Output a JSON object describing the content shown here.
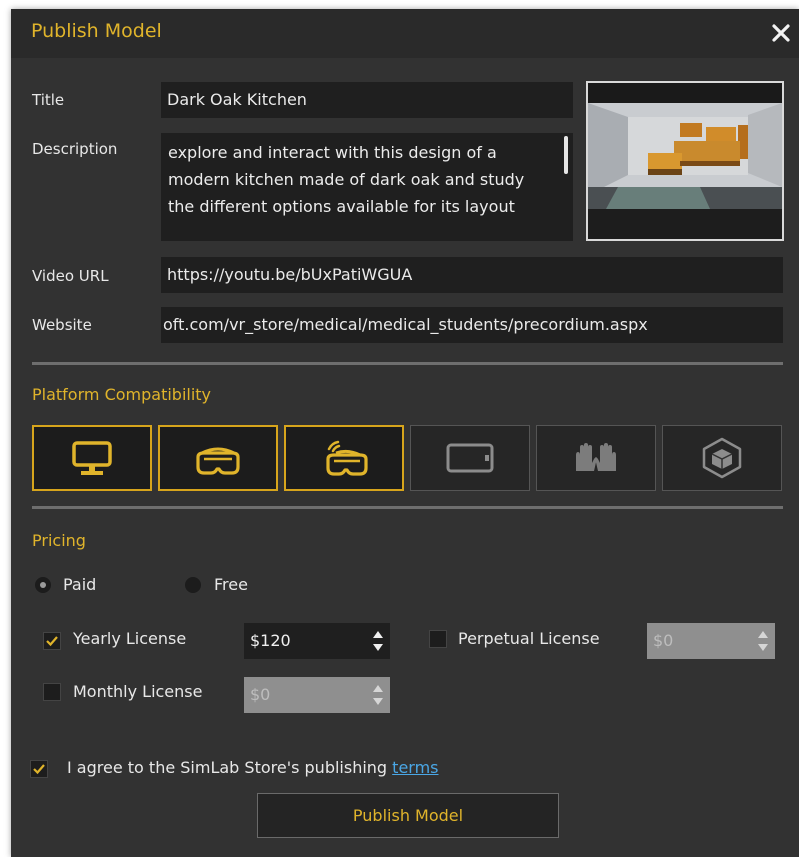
{
  "dialog": {
    "title": "Publish Model"
  },
  "form": {
    "title_label": "Title",
    "title_value": "Dark Oak Kitchen",
    "description_label": "Description",
    "description_value": "explore and interact with this design of a modern kitchen made of dark oak and study the different options available for its layout",
    "video_label": "Video URL",
    "video_value": "https://youtu.be/bUxPatiWGUA",
    "website_label": "Website",
    "website_value": "oft.com/vr_store/medical/medical_students/precordium.aspx"
  },
  "platform": {
    "heading": "Platform Compatibility",
    "items": [
      {
        "icon": "desktop-monitor-icon",
        "selected": true
      },
      {
        "icon": "vr-headset-icon",
        "selected": true
      },
      {
        "icon": "wireless-vr-headset-icon",
        "selected": true
      },
      {
        "icon": "tablet-icon",
        "selected": false
      },
      {
        "icon": "hands-icon",
        "selected": false
      },
      {
        "icon": "ar-cube-icon",
        "selected": false
      }
    ]
  },
  "pricing": {
    "heading": "Pricing",
    "paid_label": "Paid",
    "free_label": "Free",
    "selected": "Paid",
    "yearly_label": "Yearly License",
    "yearly_checked": true,
    "yearly_value": "$120",
    "perpetual_label": "Perpetual License",
    "perpetual_checked": false,
    "perpetual_value": "$0",
    "monthly_label": "Monthly License",
    "monthly_checked": false,
    "monthly_value": "$0"
  },
  "agree": {
    "checked": true,
    "text": "I agree to the SimLab Store's publishing ",
    "link": "terms"
  },
  "publish_button": "Publish Model",
  "colors": {
    "accent": "#e0b42b",
    "background": "#323232",
    "field": "#1f1f1f",
    "link": "#4aa7e6"
  }
}
